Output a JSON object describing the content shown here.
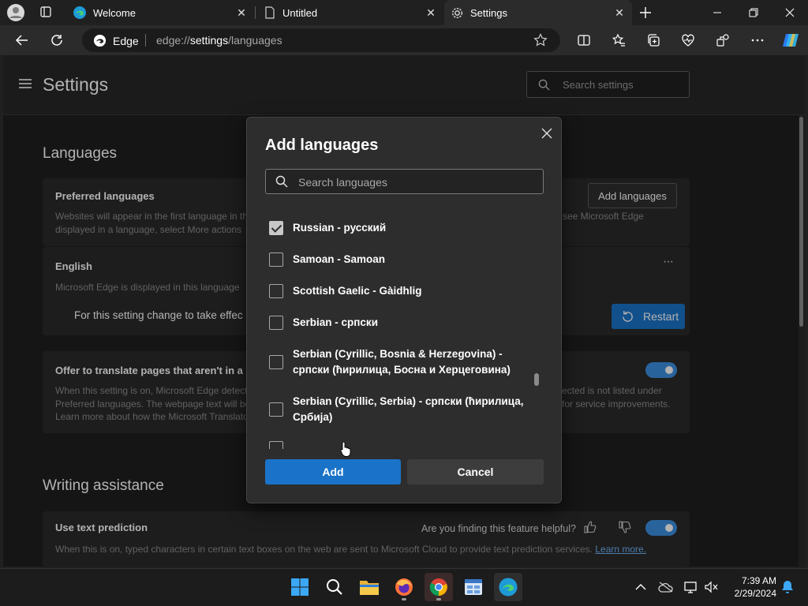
{
  "browser": {
    "tabs": [
      {
        "title": "Welcome",
        "icon": "edge-icon",
        "active": false
      },
      {
        "title": "Untitled",
        "icon": "page-icon",
        "active": false
      },
      {
        "title": "Settings",
        "icon": "gear-icon",
        "active": true
      }
    ],
    "address_bar": {
      "site_label": "Edge",
      "url_prefix": "edge://",
      "url_host": "settings",
      "url_path": "/languages"
    }
  },
  "settings": {
    "title": "Settings",
    "search_placeholder": "Search settings",
    "languages_section": {
      "title": "Languages",
      "preferred": {
        "title": "Preferred languages",
        "desc_left_1": "Websites will appear in the first language in th",
        "desc_left_2": "displayed in a language, select More actions",
        "desc_right_1": "see Microsoft Edge",
        "add_button": "Add languages"
      },
      "english": {
        "title": "English",
        "desc": "Microsoft Edge is displayed in this language",
        "restart_note": "For this setting change to take effec",
        "restart_button": "Restart",
        "more_label": "···"
      },
      "translate": {
        "title": "Offer to translate pages that aren't in a",
        "desc_left_1": "When this setting is on, Microsoft Edge detect",
        "desc_left_2": "Preferred languages. The webpage text will be",
        "desc_left_3": "Learn more about how the Microsoft Translato",
        "desc_right_1": "ected is not listed under",
        "desc_right_2": "for service improvements.",
        "toggle_on": true
      }
    },
    "writing_section": {
      "title": "Writing assistance",
      "text_prediction": {
        "title": "Use text prediction",
        "feedback_prompt": "Are you finding this feature helpful?",
        "desc": "When this is on, typed characters in certain text boxes on the web are sent to Microsoft Cloud to provide text prediction services.",
        "learn_more": "Learn more.",
        "toggle_on": true
      }
    }
  },
  "dialog": {
    "title": "Add languages",
    "search_placeholder": "Search languages",
    "languages": [
      {
        "label": "Russian - русский",
        "checked": true
      },
      {
        "label": "Samoan - Samoan",
        "checked": false
      },
      {
        "label": "Scottish Gaelic - Gàidhlig",
        "checked": false
      },
      {
        "label": "Serbian - српски",
        "checked": false
      },
      {
        "label": "Serbian (Cyrillic, Bosnia & Herzegovina) - српски (ћирилица, Босна и Херцеговина)",
        "checked": false
      },
      {
        "label": "Serbian (Cyrillic, Serbia) - српски (ћирилица, Србија)",
        "checked": false
      }
    ],
    "add_button": "Add",
    "cancel_button": "Cancel"
  },
  "taskbar": {
    "apps": [
      "start-icon",
      "search-icon",
      "file-explorer-icon",
      "firefox-icon",
      "chrome-icon",
      "windows-app-icon",
      "edge-icon"
    ],
    "time": "7:39 AM",
    "date": "2/29/2024"
  },
  "colors": {
    "accent": "#1a73c8",
    "toggle_on": "#3c8ee0",
    "link": "#6cb4f5"
  }
}
